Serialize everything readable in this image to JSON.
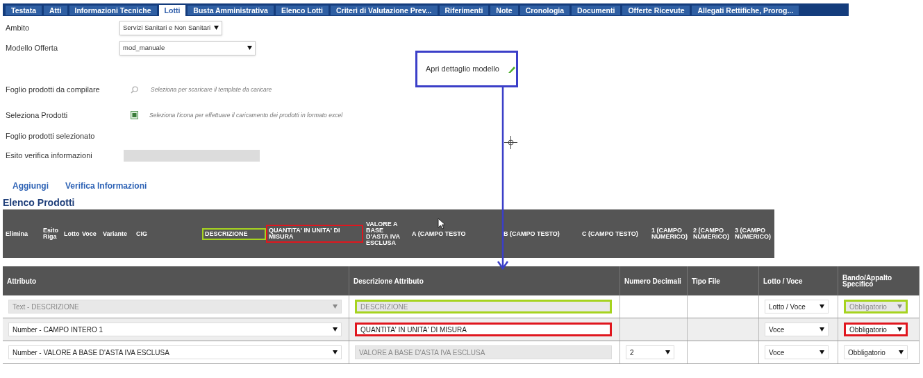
{
  "tabs": [
    {
      "label": "Testata",
      "selected": false
    },
    {
      "label": "Atti",
      "selected": false
    },
    {
      "label": "Informazioni Tecniche",
      "selected": false
    },
    {
      "label": "Lotti",
      "selected": true
    },
    {
      "label": "Busta Amministrativa",
      "selected": false
    },
    {
      "label": "Elenco Lotti",
      "selected": false
    },
    {
      "label": "Criteri di Valutazione Prev...",
      "selected": false
    },
    {
      "label": "Riferimenti",
      "selected": false
    },
    {
      "label": "Note",
      "selected": false
    },
    {
      "label": "Cronologia",
      "selected": false
    },
    {
      "label": "Documenti",
      "selected": false
    },
    {
      "label": "Offerte Ricevute",
      "selected": false
    },
    {
      "label": "Allegati Rettifiche, Prorog...",
      "selected": false
    }
  ],
  "form": {
    "ambito": {
      "label": "Ambito",
      "value": "Servizi Sanitari e Non Sanitari"
    },
    "modello_offerta": {
      "label": "Modello Offerta",
      "value": "mod_manuale"
    },
    "foglio_da_compilare": {
      "label": "Foglio prodotti da compilare",
      "hint": "Seleziona per scaricare il template da caricare"
    },
    "seleziona_prodotti": {
      "label": "Seleziona Prodotti",
      "hint": "Seleziona l'icona per effettuare il caricamento dei prodotti in formato excel"
    },
    "foglio_selezionato": {
      "label": "Foglio prodotti selezionato"
    },
    "esito_verifica": {
      "label": "Esito verifica informazioni"
    }
  },
  "annotation": {
    "text": "Apri dettaglio modello"
  },
  "actions": [
    "Aggiungi",
    "Verifica Informazioni"
  ],
  "section_title": "Elenco Prodotti",
  "products_header": [
    {
      "label": "Elimina"
    },
    {
      "label": "Esito Riga"
    },
    {
      "label": "Lotto"
    },
    {
      "label": "Voce"
    },
    {
      "label": "Variante"
    },
    {
      "label": "CIG"
    },
    {
      "label": "DESCRIZIONE",
      "color": "#a6d31f"
    },
    {
      "label": "QUANTITA' IN UNITA' DI MISURA",
      "color": "#e0161e"
    },
    {
      "label": "VALORE A BASE D'ASTA IVA ESCLUSA"
    },
    {
      "label": "A (CAMPO TESTO"
    },
    {
      "label": "B (CAMPO TESTO)"
    },
    {
      "label": "C (CAMPO TESTO)"
    },
    {
      "label": "1 (CAMPO NUMERICO)"
    },
    {
      "label": "2 (CAMPO NUMERICO)"
    },
    {
      "label": "3 (CAMPO NUMERICO)"
    }
  ],
  "attributes_table": {
    "columns": [
      "Attributo",
      "Descrizione Attributo",
      "Numero Decimali",
      "Tipo File",
      "Lotto / Voce",
      "Bando/Appalto Specifico"
    ],
    "rows": [
      {
        "attributo": {
          "value": "Text - DESCRIZIONE",
          "disabled": true
        },
        "descrizione": {
          "value": "DESCRIZIONE",
          "disabled": true,
          "color": "#a6d31f"
        },
        "lotto_voce": {
          "value": "Lotto / Voce"
        },
        "bando": {
          "value": "Obbligatorio",
          "disabled": true,
          "color": "#a6d31f"
        }
      },
      {
        "attributo": {
          "value": "Number - CAMPO INTERO 1",
          "disabled": false
        },
        "descrizione": {
          "value": "QUANTITA' IN UNITA' DI MISURA",
          "disabled": false,
          "color": "#e0161e"
        },
        "lotto_voce": {
          "value": "Voce"
        },
        "bando": {
          "value": "Obbligatorio",
          "disabled": false,
          "color": "#e0161e"
        }
      },
      {
        "attributo": {
          "value": "Number - VALORE A BASE D'ASTA IVA ESCLUSA",
          "disabled": false
        },
        "descrizione": {
          "value": "VALORE A BASE D'ASTA IVA ESCLUSA",
          "disabled": true
        },
        "decimali": {
          "value": "2"
        },
        "lotto_voce": {
          "value": "Voce"
        },
        "bando": {
          "value": "Obbligatorio",
          "disabled": false
        }
      }
    ]
  }
}
